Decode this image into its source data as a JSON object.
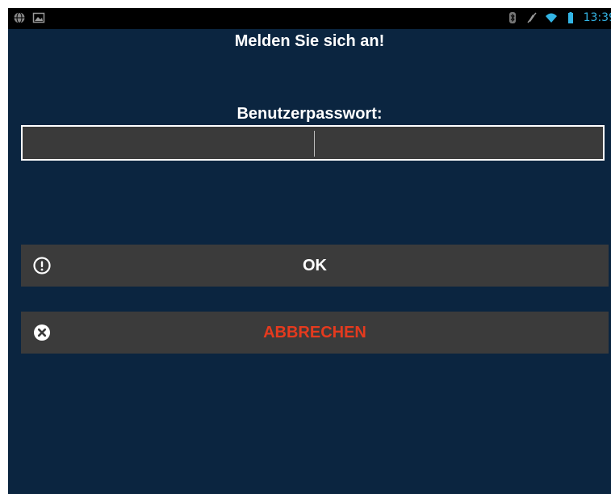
{
  "status_bar": {
    "time": "13:39",
    "left_icons": [
      "globe-icon",
      "image-icon"
    ],
    "right_icons": [
      "bluetooth-icon",
      "mute-icon",
      "wifi-icon",
      "battery-icon"
    ],
    "time_color": "#33b5e5"
  },
  "dialog": {
    "title": "Melden Sie sich an!",
    "password_label": "Benutzerpasswort:",
    "password_value": ""
  },
  "buttons": {
    "ok": {
      "label": "OK",
      "icon": "exclamation-circle-icon",
      "label_color": "#ffffff"
    },
    "cancel": {
      "label": "ABBRECHEN",
      "icon": "close-circle-icon",
      "label_color": "#e53a1e"
    }
  },
  "colors": {
    "background": "#0b2540",
    "button_background": "#3b3b3b",
    "field_background": "#3a3a3a"
  }
}
